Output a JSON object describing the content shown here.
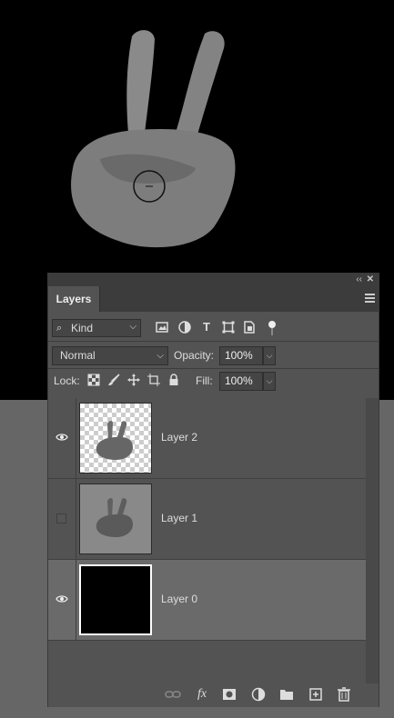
{
  "panel": {
    "tab_label": "Layers",
    "collapse_glyph": "‹‹",
    "close_glyph": "✕"
  },
  "filter": {
    "kind_label": "Kind",
    "icons": [
      "image-filter-icon",
      "adjustment-filter-icon",
      "type-filter-icon",
      "shape-filter-icon",
      "smart-object-filter-icon"
    ]
  },
  "blend": {
    "mode": "Normal",
    "opacity_label": "Opacity:",
    "opacity_value": "100%"
  },
  "lock": {
    "label": "Lock:",
    "fill_label": "Fill:",
    "fill_value": "100%",
    "icons": [
      "lock-transparent-pixels-icon",
      "lock-image-pixels-icon",
      "lock-position-icon",
      "lock-artboard-icon",
      "lock-all-icon"
    ]
  },
  "layers": [
    {
      "name": "Layer 2",
      "visible": true,
      "thumbnail": "hand-on-transparent",
      "selected": false
    },
    {
      "name": "Layer 1",
      "visible": false,
      "thumbnail": "hand-on-gray",
      "selected": false
    },
    {
      "name": "Layer 0",
      "visible": true,
      "thumbnail": "black-fill",
      "selected": true
    }
  ],
  "bottom_toolbar": {
    "icons": [
      "link-layers-icon",
      "fx-icon",
      "add-mask-icon",
      "adjustment-layer-icon",
      "new-group-icon",
      "new-layer-icon",
      "delete-layer-icon"
    ],
    "fx_text": "fx"
  },
  "colors": {
    "panel_bg": "#535353",
    "selected_row": "#6a6a6a",
    "canvas_bg": "#000000",
    "workspace_bg": "#666666"
  }
}
